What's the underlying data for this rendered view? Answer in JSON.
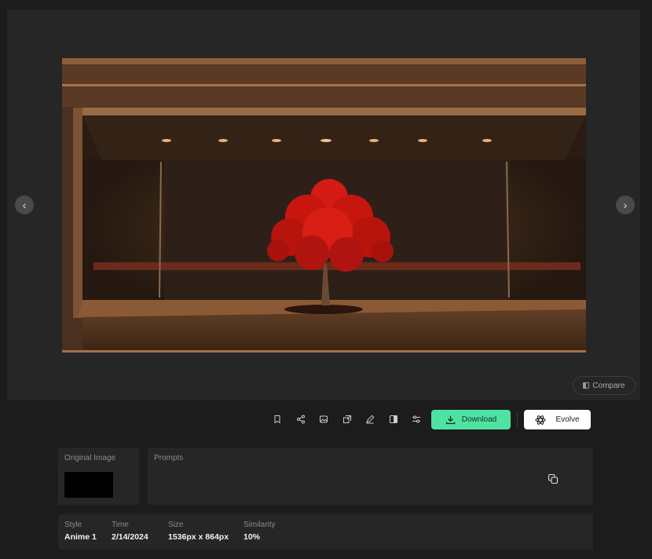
{
  "viewer": {
    "image_subject": "red tree on a wooden stage",
    "compare_label": "Compare",
    "prev_icon": "chevron-left-icon",
    "next_icon": "chevron-right-icon"
  },
  "toolbar": {
    "tools": [
      "bookmark-icon",
      "share-icon",
      "image-icon",
      "upscale-icon",
      "edit-brush-icon",
      "contrast-icon",
      "adjust-icon"
    ],
    "download_label": "Download",
    "evolve_label": "Evolve"
  },
  "details": {
    "original_image_label": "Original Image",
    "prompts_label": "Prompts",
    "prompts_text": "",
    "meta": [
      {
        "label": "Style",
        "value": "Anime 1"
      },
      {
        "label": "Time",
        "value": "2/14/2024"
      },
      {
        "label": "Size",
        "value": "1536px x 864px"
      },
      {
        "label": "Similarity",
        "value": "10%"
      }
    ]
  },
  "colors": {
    "accent": "#4fe3a3",
    "background": "#1c1c1c",
    "panel": "#262626"
  }
}
